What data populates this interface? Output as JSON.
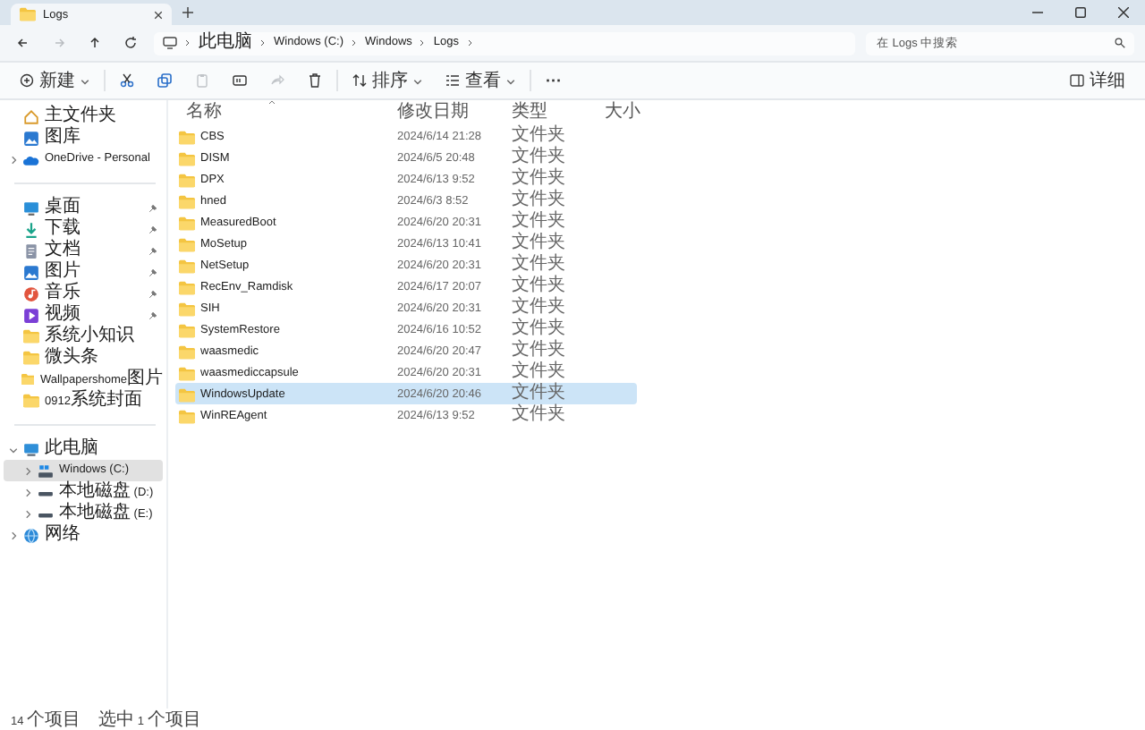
{
  "tab": {
    "title": "Logs"
  },
  "nav_buttons": [
    {
      "kind": "back",
      "disabled": false
    },
    {
      "kind": "forward",
      "disabled": true
    },
    {
      "kind": "up",
      "disabled": false
    },
    {
      "kind": "refresh",
      "disabled": false
    }
  ],
  "address": {
    "path": [
      "此电脑",
      "Windows (C:)",
      "Windows",
      "Logs"
    ]
  },
  "search": {
    "placeholder": "在 Logs 中搜索"
  },
  "toolbar": [
    {
      "kind": "new",
      "label": "新建",
      "disabled": false
    },
    {
      "kind": "cut",
      "disabled": false
    },
    {
      "kind": "copy",
      "disabled": false
    },
    {
      "kind": "paste",
      "disabled": true
    },
    {
      "kind": "rename",
      "disabled": false
    },
    {
      "kind": "share",
      "disabled": true
    },
    {
      "kind": "delete",
      "disabled": false
    },
    {
      "kind": "sort",
      "label": "排序",
      "disabled": false
    },
    {
      "kind": "view",
      "label": "查看",
      "disabled": false
    },
    {
      "kind": "more",
      "label": "···",
      "disabled": false
    }
  ],
  "details_button": {
    "label": "详细"
  },
  "sidebar": {
    "groups": [
      [
        {
          "kind": "home",
          "label": "主文件夹",
          "selected": false
        },
        {
          "kind": "gallery",
          "label": "图库",
          "selected": false
        },
        {
          "kind": "cloud",
          "label": "OneDrive - Personal",
          "selected": false,
          "expanded": false
        }
      ],
      [
        {
          "kind": "desktop",
          "label": "桌面",
          "selected": false,
          "pinned": true
        },
        {
          "kind": "download",
          "label": "下载",
          "selected": false,
          "pinned": true
        },
        {
          "kind": "document",
          "label": "文档",
          "selected": false,
          "pinned": true
        },
        {
          "kind": "gallery",
          "label": "图片",
          "selected": false,
          "pinned": true
        },
        {
          "kind": "music",
          "label": "音乐",
          "selected": false,
          "pinned": true
        },
        {
          "kind": "video",
          "label": "视频",
          "selected": false,
          "pinned": true
        },
        {
          "kind": "folder",
          "label": "系统小知识",
          "selected": false,
          "pinned": false
        },
        {
          "kind": "folder",
          "label": "微头条",
          "selected": false,
          "pinned": false
        },
        {
          "kind": "folder",
          "label": "Wallpapershome图片",
          "selected": false,
          "pinned": false
        },
        {
          "kind": "folder",
          "label": "0912系统封面",
          "selected": false,
          "pinned": false
        }
      ],
      [
        {
          "kind": "pc",
          "label": "此电脑",
          "selected": false,
          "expanded": true,
          "children": [
            {
              "kind": "system-drive",
              "label": "Windows (C:)",
              "selected": true,
              "expanded": false
            },
            {
              "kind": "drive",
              "label": "本地磁盘 (D:)",
              "selected": false,
              "expanded": false
            },
            {
              "kind": "drive",
              "label": "本地磁盘 (E:)",
              "selected": false,
              "expanded": false
            }
          ]
        },
        {
          "kind": "network",
          "label": "网络",
          "selected": false,
          "expanded": false
        }
      ]
    ]
  },
  "table": {
    "columns": [
      {
        "label": "名称",
        "sorted": true
      },
      {
        "label": "修改日期",
        "sorted": false
      },
      {
        "label": "类型",
        "sorted": false
      },
      {
        "label": "大小",
        "sorted": false
      }
    ],
    "rows": [
      {
        "name": "CBS",
        "date": "2024/6/14 21:28",
        "type": "文件夹",
        "selected": false
      },
      {
        "name": "DISM",
        "date": "2024/6/5 20:48",
        "type": "文件夹",
        "selected": false
      },
      {
        "name": "DPX",
        "date": "2024/6/13 9:52",
        "type": "文件夹",
        "selected": false
      },
      {
        "name": "hned",
        "date": "2024/6/3 8:52",
        "type": "文件夹",
        "selected": false
      },
      {
        "name": "MeasuredBoot",
        "date": "2024/6/20 20:31",
        "type": "文件夹",
        "selected": false
      },
      {
        "name": "MoSetup",
        "date": "2024/6/13 10:41",
        "type": "文件夹",
        "selected": false
      },
      {
        "name": "NetSetup",
        "date": "2024/6/20 20:31",
        "type": "文件夹",
        "selected": false
      },
      {
        "name": "RecEnv_Ramdisk",
        "date": "2024/6/17 20:07",
        "type": "文件夹",
        "selected": false
      },
      {
        "name": "SIH",
        "date": "2024/6/20 20:31",
        "type": "文件夹",
        "selected": false
      },
      {
        "name": "SystemRestore",
        "date": "2024/6/16 10:52",
        "type": "文件夹",
        "selected": false
      },
      {
        "name": "waasmedic",
        "date": "2024/6/20 20:47",
        "type": "文件夹",
        "selected": false
      },
      {
        "name": "waasmediccapsule",
        "date": "2024/6/20 20:31",
        "type": "文件夹",
        "selected": false
      },
      {
        "name": "WindowsUpdate",
        "date": "2024/6/20 20:46",
        "type": "文件夹",
        "selected": true
      },
      {
        "name": "WinREAgent",
        "date": "2024/6/13 9:52",
        "type": "文件夹",
        "selected": false
      }
    ]
  },
  "status_bar": {
    "item_count": "14 个项目",
    "selection": "选中 1 个项目"
  }
}
